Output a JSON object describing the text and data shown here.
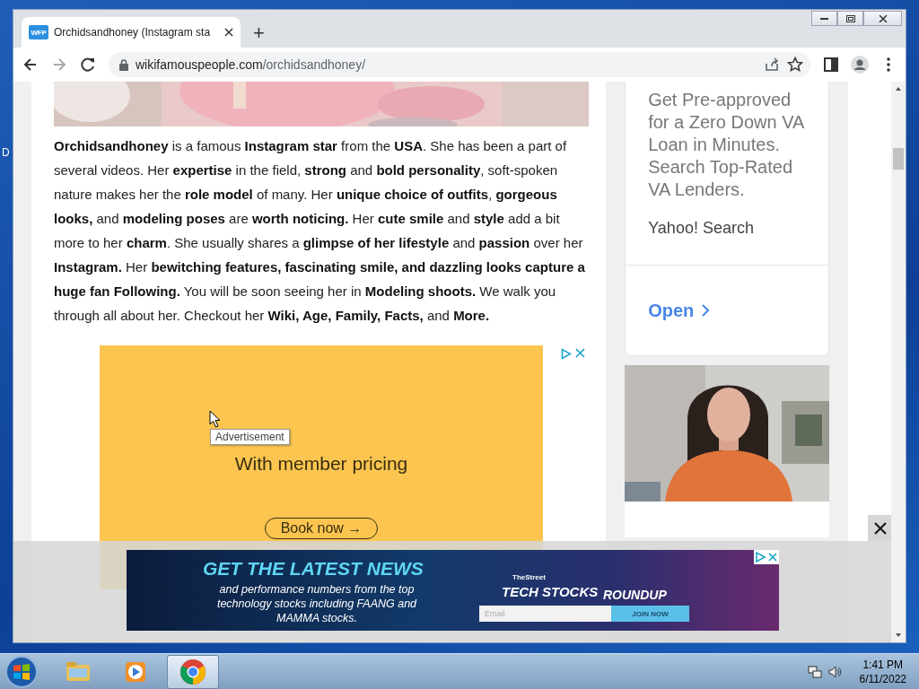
{
  "desktop": {
    "edge_text": "D"
  },
  "browser": {
    "tab": {
      "favicon": "WFP",
      "title": "Orchidsandhoney (Instagram sta",
      "selected": true
    },
    "new_tab": "+",
    "address": {
      "domain": "wikifamouspeople.com",
      "path": "/orchidsandhoney/"
    }
  },
  "article": {
    "paragraph": "**Orchidsandhoney** is a famous **Instagram star** from the **USA**. She has been a part of several videos. Her **expertise** in the field, **strong** and **bold personality**, soft-spoken nature makes her the **role model** of many. Her **unique choice of outfits**, **gorgeous looks,** and **modeling poses** are **worth noticing.** Her **cute smile** and **style** add a bit more to her **charm**. She usually shares a **glimpse of her lifestyle** and **passion** over her **Instagram.** Her **bewitching features, fascinating smile, and dazzling looks capture a huge fan Following.** You will be soon seeing her in **Modeling shoots.**  We walk you through all about her. Checkout her **Wiki, Age,  Family,  Facts,** and **More.**",
    "ad": {
      "tooltip": "Advertisement",
      "headline": "With member pricing",
      "button": "Book now →"
    }
  },
  "sidebar_ad": {
    "text": "Get Pre-approved for a Zero Down VA Loan in Minutes. Search Top-Rated VA Lenders.",
    "source": "Yahoo! Search",
    "link": "Open"
  },
  "bottom_banner": {
    "headline": "GET THE LATEST NEWS",
    "body": "and performance numbers from the top technology stocks including FAANG and MAMMA stocks.",
    "brand": "TheStreet",
    "title": "TECH STOCKS",
    "subtitle": "ROUNDUP",
    "email_placeholder": "Email",
    "button": "JOIN NOW"
  },
  "taskbar": {
    "apps": [
      {
        "kind": "explorer",
        "selected": false
      },
      {
        "kind": "media",
        "selected": false
      },
      {
        "kind": "chrome",
        "selected": true
      }
    ],
    "time": "1:41 PM",
    "date": "6/11/2022"
  }
}
